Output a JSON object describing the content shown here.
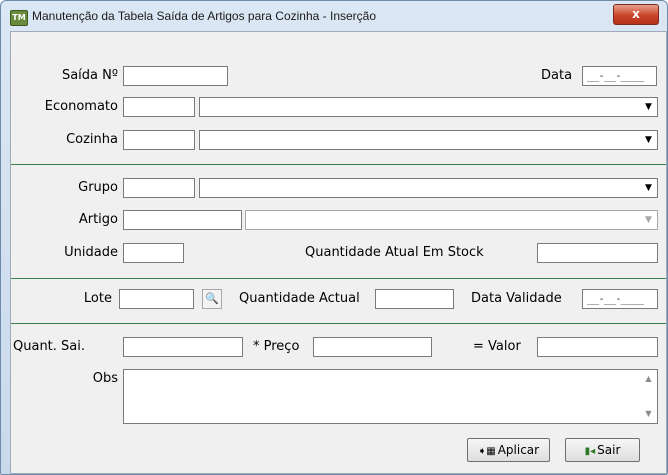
{
  "window": {
    "title": "Manutenção da Tabela Saída de Artigos para Cozinha - Inserção",
    "close_label": "x",
    "icon_text": "TM"
  },
  "header": {
    "saida_label": "Saída Nº",
    "saida_value": "",
    "data_label": "Data",
    "data_value": "__-__-____",
    "economato_label": "Economato",
    "economato_code": "",
    "economato_desc": "",
    "cozinha_label": "Cozinha",
    "cozinha_code": "",
    "cozinha_desc": ""
  },
  "artigo": {
    "grupo_label": "Grupo",
    "artigo_label": "Artigo",
    "unidade_label": "Unidade",
    "stock_label": "Quantidade Atual Em Stock"
  },
  "lote": {
    "lote_label": "Lote",
    "qtd_actual_label": "Quantidade Actual",
    "validade_label": "Data Validade",
    "validade_value": "__-__-____"
  },
  "calc": {
    "quant_label": "Quant. Sai.",
    "preco_label": "* Preço",
    "valor_label": "= Valor",
    "obs_label": "Obs"
  },
  "buttons": {
    "aplicar_label": "Aplicar",
    "sair_label": "Sair"
  },
  "icons": {
    "dropdown": "chevron-down-icon",
    "binoculars": "binoculars-icon",
    "apply": "apply-icon",
    "exit": "exit-door-icon"
  },
  "colors": {
    "separator": "#3a7f4a",
    "close": "#c9442a"
  }
}
